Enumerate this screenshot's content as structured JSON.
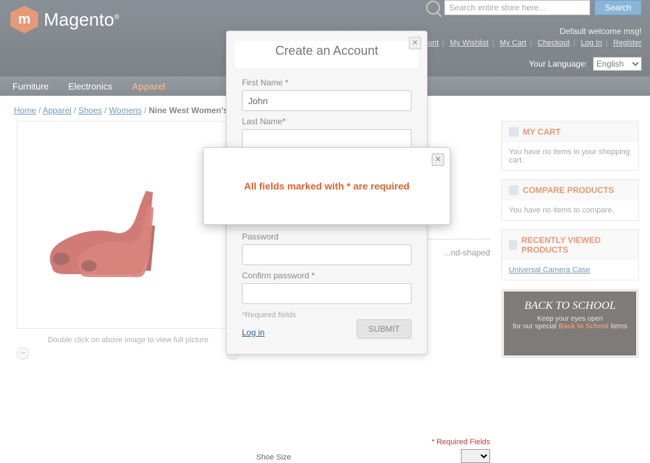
{
  "header": {
    "logo_text": "Magento",
    "search_placeholder": "Search entire store here...",
    "search_button": "Search",
    "welcome": "Default welcome msg!",
    "links": {
      "account": "...ccount",
      "wishlist": "My Wishlist",
      "cart": "My Cart",
      "checkout": "Checkout",
      "login": "Log In",
      "register": "Register"
    },
    "lang_label": "Your Language:",
    "lang_value": "English"
  },
  "nav": {
    "furniture": "Furniture",
    "electronics": "Electronics",
    "apparel": "Apparel"
  },
  "crumb": {
    "home": "Home",
    "apparel": "Apparel",
    "shoes": "Shoes",
    "womens": "Womens",
    "current": "Nine West Women's Lu..."
  },
  "product": {
    "hint": "Double click on above image to view full picture",
    "desc_partial": "...nd-shaped",
    "required": "* Required Fields",
    "size_label": "Shoe Size"
  },
  "sidebar": {
    "cart": {
      "title": "MY CART",
      "body": "You have no items in your shopping cart."
    },
    "compare": {
      "title": "COMPARE PRODUCTS",
      "body": "You have no items to compare."
    },
    "recent": {
      "title": "RECENTLY VIEWED PRODUCTS",
      "link": "Universal Camera Case"
    },
    "promo": {
      "title": "BACK TO SCHOOL",
      "line1": "Keep your eyes open",
      "line2": "for our special ",
      "bold": "Back to School",
      "line3": " items"
    }
  },
  "modal": {
    "title": "Create an Account",
    "first_name": "First Name",
    "first_val": "John",
    "last_name": "Last Name",
    "password": "Password",
    "confirm": "Confirm password",
    "required_note": "*Required fields",
    "submit": "SUBMIT",
    "login": "Log in"
  },
  "alert": {
    "text": "All fields marked with * are required"
  }
}
